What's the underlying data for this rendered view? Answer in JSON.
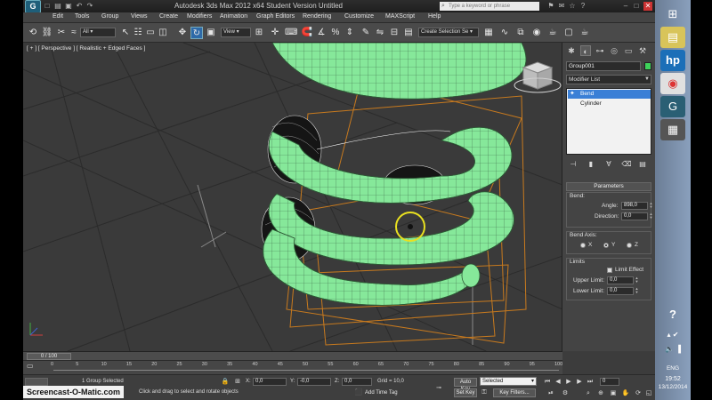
{
  "window": {
    "title": "Autodesk 3ds Max  2012 x64    Student Version    Untitled",
    "logo_text": "G",
    "search_placeholder": "Type a keyword or phrase"
  },
  "menu": [
    "Edit",
    "Tools",
    "Group",
    "Views",
    "Create",
    "Modifiers",
    "Animation",
    "Graph Editors",
    "Rendering",
    "Customize",
    "MAXScript",
    "Help"
  ],
  "toolbar": {
    "selection_filter": "All",
    "ref_coord": "View",
    "named_selection": "Create Selection Se"
  },
  "viewport": {
    "label": "[ + ] [ Perspective ] [ Realistic + Edged Faces ]",
    "object_color": "#86e89a",
    "gizmo_color": "#c87a1e",
    "highlight_color": "#e8e020"
  },
  "command_panel": {
    "object_name": "Group001",
    "object_color": "#3ed25a",
    "modifier_list": "Modifier List",
    "stack": [
      {
        "label": "Bend",
        "selected": true
      },
      {
        "label": "Cylinder",
        "selected": false
      }
    ],
    "rollout_title": "Parameters",
    "bend_group": "Bend:",
    "angle_label": "Angle:",
    "angle_value": "898,0",
    "direction_label": "Direction:",
    "direction_value": "0,0",
    "bend_axis_group": "Bend Axis:",
    "axis_options": [
      {
        "label": "X",
        "selected": false
      },
      {
        "label": "Y",
        "selected": true
      },
      {
        "label": "Z",
        "selected": false
      }
    ],
    "limits_group": "Limits",
    "limit_effect_label": "Limit Effect",
    "upper_limit_label": "Upper Limit:",
    "upper_limit_value": "0,0",
    "lower_limit_label": "Lower Limit:",
    "lower_limit_value": "0,0"
  },
  "timeline": {
    "frame_display": "0 / 100",
    "ticks": [
      "0",
      "5",
      "10",
      "15",
      "20",
      "25",
      "30",
      "35",
      "40",
      "45",
      "50",
      "55",
      "60",
      "65",
      "70",
      "75",
      "80",
      "85",
      "90",
      "95",
      "100"
    ]
  },
  "status": {
    "selection_info": "1 Group Selected",
    "prompt": "Click and drag to select and rotate objects",
    "x_label": "X:",
    "x_value": "0,0",
    "y_label": "Y:",
    "y_value": "-0,0",
    "z_label": "Z:",
    "z_value": "0,0",
    "grid": "Grid = 10,0",
    "add_time_tag": "Add Time Tag",
    "auto_key": "Auto Key",
    "set_key": "Set Key",
    "selected_dropdown": "Selected",
    "key_filters": "Key Filters...",
    "frame_spinner": "0"
  },
  "watermark": "Screencast-O-Matic.com",
  "taskbar": {
    "lang": "ENG",
    "time": "19:52",
    "date": "13/12/2014"
  }
}
